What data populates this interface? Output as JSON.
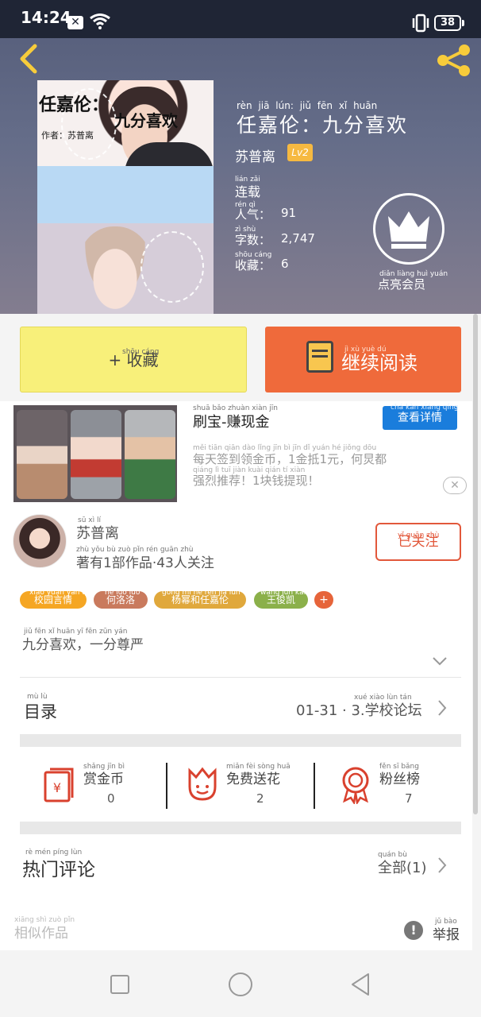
{
  "status_bar": {
    "time": "14:24",
    "battery": "38"
  },
  "book": {
    "title_pinyin": "rèn jiā lún:  jiǔ fēn xǐ huān",
    "title": "任嘉伦：九分喜欢",
    "author": "苏普离",
    "level": "Lv2",
    "status_pinyin": "lián zǎi",
    "status": "连载",
    "popularity_pinyin": "rén qì",
    "popularity_label": "人气：",
    "popularity": "91",
    "words_pinyin": "zì shù",
    "words_label": "字数：",
    "words": "2,747",
    "favorites_pinyin": "shōu cáng",
    "favorites_label": "收藏：",
    "favorites": "6",
    "cover_title_1": "任嘉伦：",
    "cover_title_2": "九分喜欢",
    "cover_author": "作者：苏普离"
  },
  "crown": {
    "label_pinyin": "diǎn liàng huì yuán",
    "label": "点亮会员"
  },
  "actions": {
    "favorite_pinyin": "shōu cáng",
    "favorite": "+ 收藏",
    "read_pinyin": "jì xù yuè dú",
    "read": "继续阅读"
  },
  "ad": {
    "title_pinyin": "shuā bǎo  zhuàn xiàn jīn",
    "title": "刷宝-赚现金",
    "detail_pinyin": "chá kàn xiáng qíng",
    "detail": "查看详情",
    "desc_pinyin_1": "měi tiān qiān dào lǐng jīn bì     jīn dǐ yuán     hé jiǒng dōu",
    "desc_line_1": "每天签到领金币，1金抵1元，何炅都",
    "desc_pinyin_2": "qiáng lì tuī jiàn   kuài qián tí xiàn",
    "desc_line_2": "强烈推荐！1块钱提现！",
    "close": "✕"
  },
  "author_card": {
    "name_pinyin": "sū xì lí",
    "name": "苏普离",
    "info_pinyin": "zhù yǒu  bù zuò pǐn    rén guān zhù",
    "info": "著有1部作品·43人关注",
    "follow_pinyin": "yǐ guān zhù",
    "follow": "已关注"
  },
  "tags": [
    {
      "pinyin": "xiào yuán yán qíng",
      "label": "校园言情",
      "color": "#f5a623"
    },
    {
      "pinyin": "hé luò luò",
      "label": "何洛洛",
      "color": "#c97a5d"
    },
    {
      "pinyin": "gōng mì hé rèn jiā lún",
      "label": "杨幂和任嘉伦",
      "color": "#e0a83c"
    },
    {
      "pinyin": "wáng jùn kǎi",
      "label": "王俊凯",
      "color": "#8bb04a"
    }
  ],
  "tag_add": "+",
  "intro": {
    "pinyin": "jiǔ fēn xǐ huān     yī fēn zūn yán",
    "text": "九分喜欢，一分尊严"
  },
  "catalog": {
    "label_pinyin": "mù lù",
    "label": "目录",
    "latest_pinyin": "xué xiào lùn tán",
    "latest": "01-31 · 3.学校论坛"
  },
  "support": [
    {
      "pinyin": "shǎng jīn bì",
      "label": "赏金币",
      "count": "0",
      "icon": "coin-envelope-icon"
    },
    {
      "pinyin": "miǎn fèi sòng huā",
      "label": "免费送花",
      "count": "2",
      "icon": "flower-icon"
    },
    {
      "pinyin": "fěn sī bǎng",
      "label": "粉丝榜",
      "count": "7",
      "icon": "medal-icon"
    }
  ],
  "comments": {
    "label_pinyin": "rè mén píng lùn",
    "label": "热门评论",
    "all_pinyin": "quán bù",
    "all": "全部(1)"
  },
  "related": {
    "pinyin": "xiāng shì zuò pǐn",
    "label": "相似作品"
  },
  "report": {
    "pinyin": "jǔ bào",
    "label": "举报",
    "icon_glyph": "!"
  },
  "colors": {
    "accent": "#ef6a3b",
    "favorite_bg": "#f8f07a",
    "ad_button": "#1a7ddc",
    "follow": "#e2583b"
  }
}
